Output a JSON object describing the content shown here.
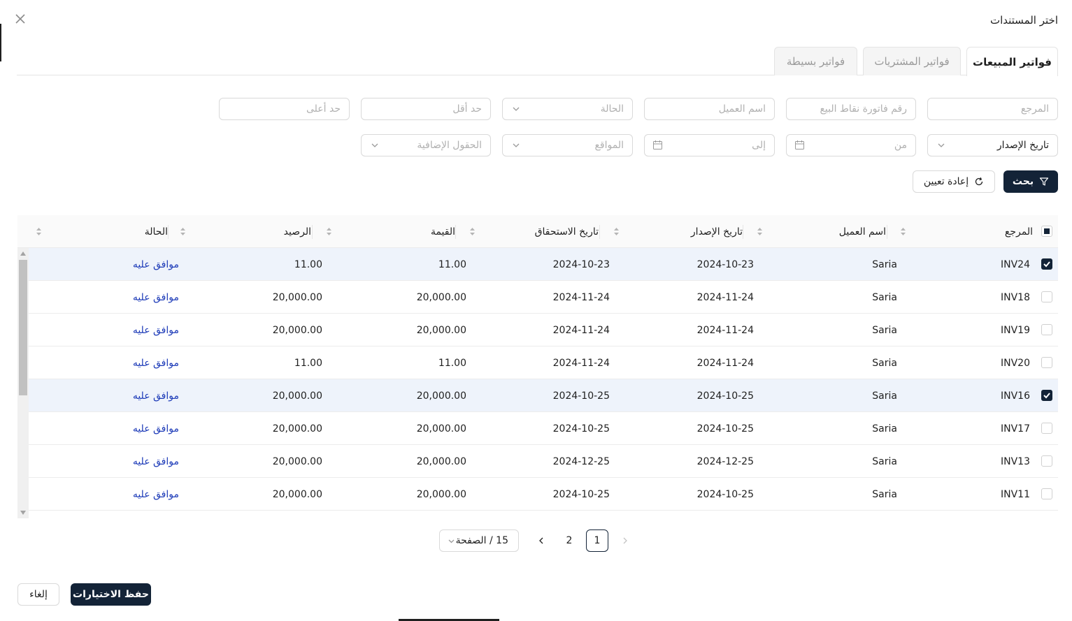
{
  "dialog": {
    "title": "اختر المستندات",
    "close_icon": "close-icon"
  },
  "tabs": [
    {
      "label": "فواتير المبيعات",
      "active": true
    },
    {
      "label": "فواتير المشتريات",
      "active": false
    },
    {
      "label": "فواتير بسيطة",
      "active": false
    }
  ],
  "filters": {
    "reference_placeholder": "المرجع",
    "pos_invoice_placeholder": "رقم فاتورة نقاط البيع",
    "customer_placeholder": "اسم العميل",
    "status_placeholder": "الحالة",
    "min_placeholder": "حد أقل",
    "max_placeholder": "حد أعلى",
    "date_type_value": "تاريخ الإصدار",
    "from_placeholder": "من",
    "to_placeholder": "إلى",
    "locations_placeholder": "المواقع",
    "extra_fields_placeholder": "الحقول الإضافية"
  },
  "actions": {
    "search_label": "بحث",
    "reset_label": "إعادة تعيين"
  },
  "table": {
    "columns": [
      "المرجع",
      "اسم العميل",
      "تاريخ الإصدار",
      "تاريخ الاستحقاق",
      "القيمة",
      "الرصيد",
      "الحالة"
    ],
    "rows": [
      {
        "ref": "INV24",
        "customer": "Saria",
        "issue": "2024-10-23",
        "due": "2024-10-23",
        "amount": "11.00",
        "balance": "11.00",
        "status": "موافق عليه",
        "selected": true
      },
      {
        "ref": "INV18",
        "customer": "Saria",
        "issue": "2024-11-24",
        "due": "2024-11-24",
        "amount": "20,000.00",
        "balance": "20,000.00",
        "status": "موافق عليه",
        "selected": false
      },
      {
        "ref": "INV19",
        "customer": "Saria",
        "issue": "2024-11-24",
        "due": "2024-11-24",
        "amount": "20,000.00",
        "balance": "20,000.00",
        "status": "موافق عليه",
        "selected": false
      },
      {
        "ref": "INV20",
        "customer": "Saria",
        "issue": "2024-11-24",
        "due": "2024-11-24",
        "amount": "11.00",
        "balance": "11.00",
        "status": "موافق عليه",
        "selected": false
      },
      {
        "ref": "INV16",
        "customer": "Saria",
        "issue": "2024-10-25",
        "due": "2024-10-25",
        "amount": "20,000.00",
        "balance": "20,000.00",
        "status": "موافق عليه",
        "selected": true
      },
      {
        "ref": "INV17",
        "customer": "Saria",
        "issue": "2024-10-25",
        "due": "2024-10-25",
        "amount": "20,000.00",
        "balance": "20,000.00",
        "status": "موافق عليه",
        "selected": false
      },
      {
        "ref": "INV13",
        "customer": "Saria",
        "issue": "2024-12-25",
        "due": "2024-12-25",
        "amount": "20,000.00",
        "balance": "20,000.00",
        "status": "موافق عليه",
        "selected": false
      },
      {
        "ref": "INV11",
        "customer": "Saria",
        "issue": "2024-10-25",
        "due": "2024-10-25",
        "amount": "20,000.00",
        "balance": "20,000.00",
        "status": "موافق عليه",
        "selected": false
      }
    ]
  },
  "pagination": {
    "pages": [
      "1",
      "2"
    ],
    "current": "1",
    "page_size_label": "15 / الصفحة"
  },
  "footer": {
    "save_label": "حفظ الاختيارات",
    "cancel_label": "إلغاء"
  },
  "colors": {
    "primary": "#132337",
    "status_link": "#1d3bb8",
    "selected_row": "#eef3fb"
  }
}
